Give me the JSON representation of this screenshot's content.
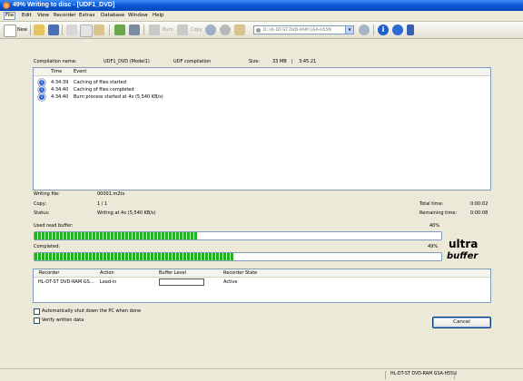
{
  "window": {
    "title": "49% Writing to disc - [UDF1_DVD]"
  },
  "menu": {
    "items": [
      "File",
      "Edit",
      "View",
      "Recorder",
      "Extras",
      "Database",
      "Window",
      "Help"
    ]
  },
  "toolbar": {
    "new_label": "New",
    "burn_label": "Burn",
    "copy_label": "Copy",
    "recorder_value": "D: HL-DT-ST DVD-RAM GSA-H55N"
  },
  "compilation": {
    "name_label": "Compilation name:",
    "name_value": "UDF1_DVD (Model1)",
    "type_value": "UDF compilation",
    "size_label": "Size:",
    "size_value": "33 MB",
    "duration_value": "3:45.21"
  },
  "log": {
    "col_time": "Time",
    "col_event": "Event",
    "rows": [
      {
        "time": "4:34:39",
        "event": "Caching of files started"
      },
      {
        "time": "4:34:40",
        "event": "Caching of files completed"
      },
      {
        "time": "4:34:40",
        "event": "Burn process started at 4x (5,540 KB/s)"
      }
    ]
  },
  "status": {
    "writing_file_label": "Writing file:",
    "writing_file_value": "00001.m2ts",
    "copy_label": "Copy:",
    "copy_value": "1 / 1",
    "status_label": "Status:",
    "status_value": "Writing at 4x (5,540 KB/s)",
    "total_time_label": "Total time:",
    "total_time_value": "0:00:02",
    "remaining_time_label": "Remaining time:",
    "remaining_time_value": "0:00:08"
  },
  "progress": {
    "read_buffer_label": "Used read buffer:",
    "read_buffer_percent_text": "40%",
    "read_buffer_fraction": 0.4,
    "completed_label": "Completed:",
    "completed_percent_text": "49%",
    "completed_fraction": 0.49
  },
  "logo": {
    "line1": "ultra",
    "line2": "buffer"
  },
  "recorders": {
    "col_recorder": "Recorder",
    "col_action": "Action",
    "col_buffer": "Buffer Level",
    "col_state": "Recorder State",
    "rows": [
      {
        "recorder": "HL-DT-ST DVD-RAM GS...",
        "action": "Lead-in",
        "buffer_fraction": 0.0,
        "state": "Active"
      }
    ]
  },
  "options": {
    "shutdown_label": "Automatically shut down the PC when done",
    "verify_label": "Verify written data"
  },
  "buttons": {
    "cancel_label": "Cancel"
  },
  "statusbar": {
    "text": "HL-DT-ST DVD-RAM GSA-H55N"
  },
  "colors": {
    "progress_fill": "#23b223",
    "titlebar": "#0a58d6"
  }
}
